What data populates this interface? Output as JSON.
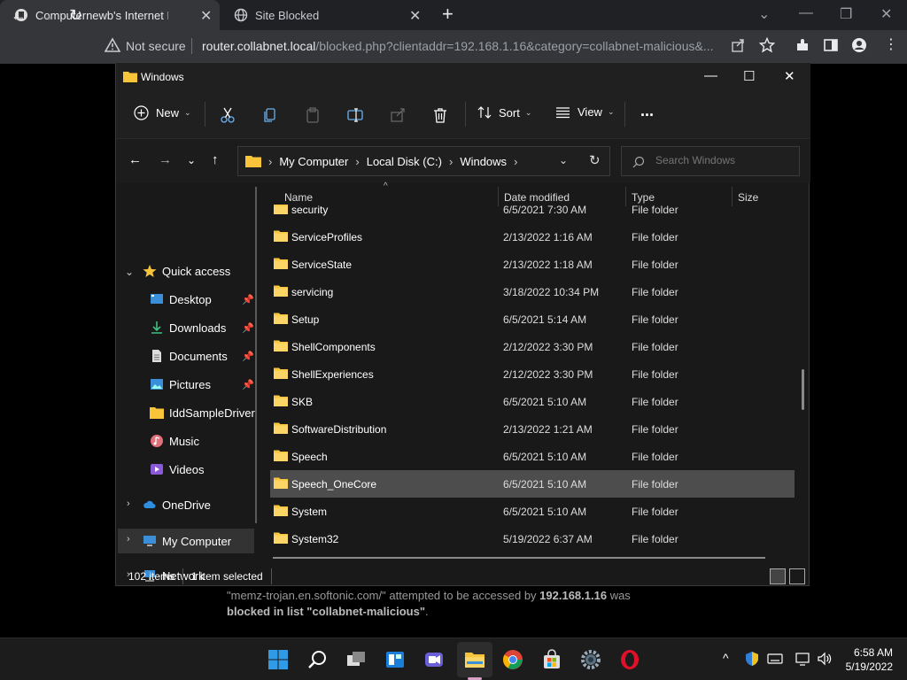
{
  "browser": {
    "tabs": [
      {
        "title": "Computernewb's Internet Pub Hu",
        "active": true
      },
      {
        "title": "Site Blocked",
        "active": false
      }
    ],
    "security_label": "Not secure",
    "url_host": "router.collabnet.local",
    "url_path": "/blocked.php?clientaddr=192.168.1.16&category=collabnet-malicious&..."
  },
  "blocked_page": {
    "line1_pre": "\"memz-trojan.en.softonic.com/\" attempted to be accessed by ",
    "ip": "192.168.1.16",
    "line1_post": " was",
    "line2_pre": "blocked in list ",
    "list": "\"collabnet-malicious\"",
    "line2_post": "."
  },
  "explorer": {
    "title": "Windows",
    "commands": {
      "new": "New",
      "sort": "Sort",
      "view": "View",
      "more": "..."
    },
    "breadcrumb": [
      "My Computer",
      "Local Disk (C:)",
      "Windows"
    ],
    "search_placeholder": "Search Windows",
    "nav": {
      "quick_access": "Quick access",
      "items": [
        "Desktop",
        "Downloads",
        "Documents",
        "Pictures",
        "IddSampleDriver",
        "Music",
        "Videos"
      ],
      "onedrive": "OneDrive",
      "my_computer": "My Computer",
      "network": "Network"
    },
    "columns": {
      "name": "Name",
      "date": "Date modified",
      "type": "Type",
      "size": "Size"
    },
    "rows": [
      {
        "name": "security",
        "date": "6/5/2021 7:30 AM",
        "type": "File folder"
      },
      {
        "name": "ServiceProfiles",
        "date": "2/13/2022 1:16 AM",
        "type": "File folder"
      },
      {
        "name": "ServiceState",
        "date": "2/13/2022 1:18 AM",
        "type": "File folder"
      },
      {
        "name": "servicing",
        "date": "3/18/2022 10:34 PM",
        "type": "File folder"
      },
      {
        "name": "Setup",
        "date": "6/5/2021 5:14 AM",
        "type": "File folder"
      },
      {
        "name": "ShellComponents",
        "date": "2/12/2022 3:30 PM",
        "type": "File folder"
      },
      {
        "name": "ShellExperiences",
        "date": "2/12/2022 3:30 PM",
        "type": "File folder"
      },
      {
        "name": "SKB",
        "date": "6/5/2021 5:10 AM",
        "type": "File folder"
      },
      {
        "name": "SoftwareDistribution",
        "date": "2/13/2022 1:21 AM",
        "type": "File folder"
      },
      {
        "name": "Speech",
        "date": "6/5/2021 5:10 AM",
        "type": "File folder"
      },
      {
        "name": "Speech_OneCore",
        "date": "6/5/2021 5:10 AM",
        "type": "File folder"
      },
      {
        "name": "System",
        "date": "6/5/2021 5:10 AM",
        "type": "File folder"
      },
      {
        "name": "System32",
        "date": "5/19/2022 6:37 AM",
        "type": "File folder"
      }
    ],
    "selected_row": "Speech_OneCore",
    "status": {
      "count": "102 items",
      "selected": "1 item selected"
    }
  },
  "taskbar": {
    "time": "6:58 AM",
    "date": "5/19/2022"
  },
  "colors": {
    "folder": "#f8c53a",
    "selection": "#4d4d4d",
    "accent": "#0078d4"
  }
}
